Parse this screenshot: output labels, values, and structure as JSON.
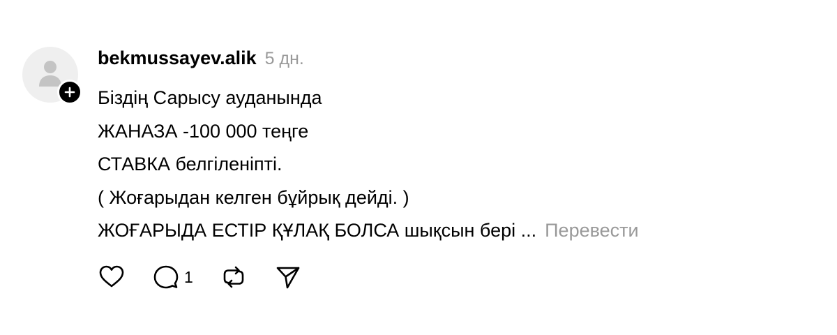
{
  "post": {
    "username": "bekmussayev.alik",
    "time": "5 дн.",
    "lines": [
      "Біздің Сарысу ауданында",
      "ЖАНАЗА -100 000 теңге",
      "СТАВКА белгіленіпті.",
      "( Жоғарыдан келген бұйрық дейді. )",
      "ЖОҒАРЫДА ЕСТІР ҚҰЛАҚ БОЛСА шықсын бері ..."
    ],
    "translate_label": "Перевести"
  },
  "actions": {
    "like_icon": "heart-icon",
    "comment_icon": "comment-bubble-icon",
    "comment_count": "1",
    "repost_icon": "repost-icon",
    "share_icon": "send-icon"
  },
  "avatar": {
    "icon": "user-silhouette-icon",
    "badge_icon": "plus-icon"
  }
}
